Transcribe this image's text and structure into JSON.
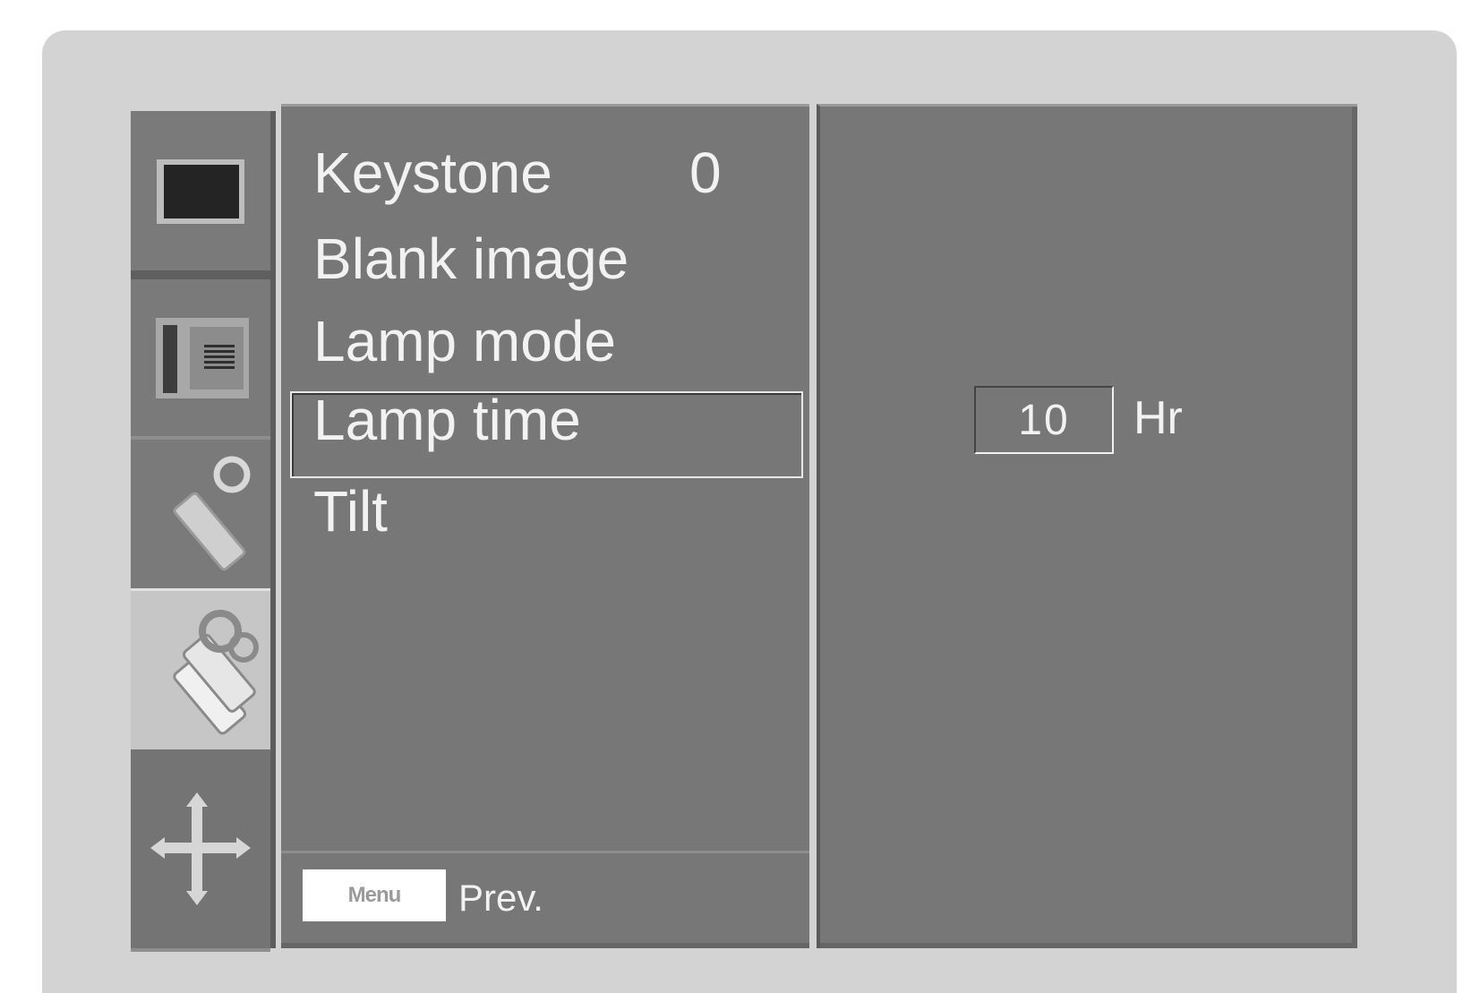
{
  "sidebar": {
    "tabs": [
      {
        "icon": "picture-icon"
      },
      {
        "icon": "screen-menu-icon"
      },
      {
        "icon": "tools-icon"
      },
      {
        "icon": "option-tools-icon"
      },
      {
        "icon": "move-arrows-icon"
      }
    ],
    "selected_index": 3
  },
  "menu": {
    "items": [
      {
        "label": "Keystone",
        "value": "0"
      },
      {
        "label": "Blank image",
        "value": ""
      },
      {
        "label": "Lamp mode",
        "value": ""
      },
      {
        "label": "Lamp time",
        "value": ""
      },
      {
        "label": "Tilt",
        "value": ""
      }
    ],
    "selected_index": 3,
    "footer": {
      "key_label": "Menu",
      "prev_label": "Prev."
    }
  },
  "detail": {
    "lamp_time_value": "10",
    "lamp_time_unit": "Hr"
  },
  "colors": {
    "panel": "#777777",
    "frame": "#d3d3d3",
    "text": "#f2f2f2",
    "selected_tab": "#c6c6c6"
  }
}
